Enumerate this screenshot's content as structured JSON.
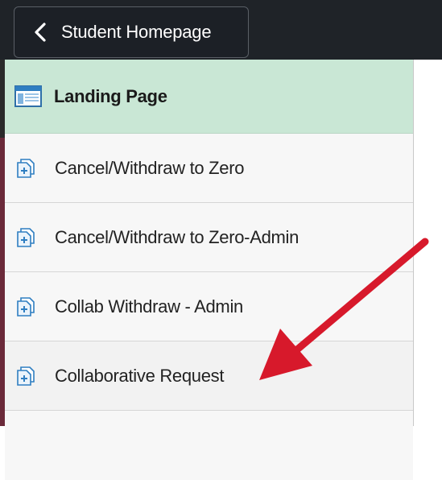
{
  "header": {
    "back_label": "Student Homepage"
  },
  "sidebar": {
    "landing": {
      "label": "Landing Page"
    },
    "items": [
      {
        "label": "Cancel/Withdraw to Zero"
      },
      {
        "label": "Cancel/Withdraw to Zero-Admin"
      },
      {
        "label": "Collab Withdraw - Admin"
      },
      {
        "label": "Collaborative Request"
      },
      {
        "label": ""
      }
    ]
  },
  "colors": {
    "topbar": "#1f2328",
    "landing_highlight": "#c9e7d5",
    "arrow": "#d7192b",
    "icon_blue": "#2f7ec1"
  },
  "icons": {
    "back": "chevron-left-icon",
    "landing": "landing-page-icon",
    "item": "document-plus-icon",
    "annotation": "red-arrow-icon"
  }
}
